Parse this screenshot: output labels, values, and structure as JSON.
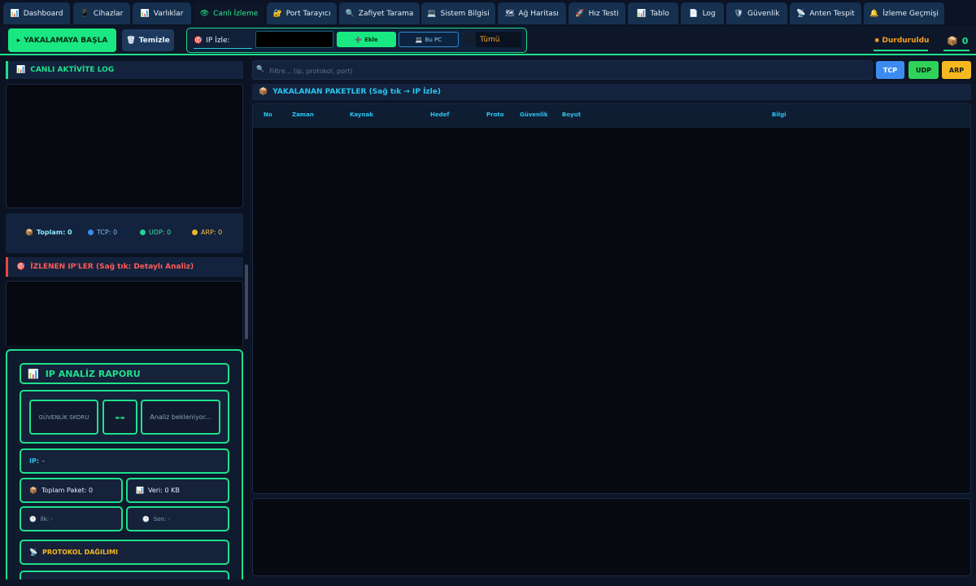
{
  "tabs": [
    {
      "icon": "📊",
      "icon_name": "chart-icon",
      "label": "Dashboard"
    },
    {
      "icon": "📱",
      "icon_name": "phone-icon",
      "label": "Cihazlar"
    },
    {
      "icon": "📊",
      "icon_name": "chart-icon",
      "label": "Varlıklar"
    },
    {
      "icon": "👁",
      "icon_name": "eye-icon",
      "label": "Canlı İzleme",
      "active": true
    },
    {
      "icon": "🔐",
      "icon_name": "lock-icon",
      "label": "Port Tarayıcı"
    },
    {
      "icon": "🔍",
      "icon_name": "search-icon",
      "label": "Zafiyet Tarama"
    },
    {
      "icon": "💻",
      "icon_name": "computer-icon",
      "label": "Sistem Bilgisi"
    },
    {
      "icon": "🗺",
      "icon_name": "map-icon",
      "label": "Ağ Haritası"
    },
    {
      "icon": "🚀",
      "icon_name": "rocket-icon",
      "label": "Hız Testi"
    },
    {
      "icon": "📊",
      "icon_name": "chart-icon",
      "label": "Tablo"
    },
    {
      "icon": "📄",
      "icon_name": "document-icon",
      "label": "Log"
    },
    {
      "icon": "🛡",
      "icon_name": "shield-icon",
      "label": "Güvenlik"
    },
    {
      "icon": "📡",
      "icon_name": "antenna-icon",
      "label": "Anten Tespit"
    },
    {
      "icon": "🔔",
      "icon_name": "bell-icon",
      "label": "İzleme Geçmişi"
    }
  ],
  "toolbar": {
    "start_label": "YAKALAMAYA BAŞLA",
    "start_icon": "▸",
    "clear_label": "Temizle",
    "clear_icon": "🗑",
    "ip_label": "IP İzle:",
    "ip_label_icon": "🎯",
    "ip_value": "",
    "add_label": "Ekle",
    "add_icon": "➕",
    "pc_label": "Bu PC",
    "pc_icon": "💻",
    "select_value": "Tümü",
    "status_label": "Durduruldu",
    "status_icon": "⏹",
    "packet_icon": "📦",
    "packet_count": "0"
  },
  "log": {
    "title": "CANLI AKTİVİTE LOG",
    "title_icon": "📊"
  },
  "stats": {
    "total": {
      "icon": "📦",
      "label": "Toplam: 0"
    },
    "tcp": {
      "label": "TCP: 0",
      "color": "#3d8bf0"
    },
    "udp": {
      "label": "UDP: 0",
      "color": "#22d39a"
    },
    "arp": {
      "label": "ARP: 0",
      "color": "#f0b429"
    }
  },
  "watched": {
    "title": "İZLENEN IP'LER (Sağ tık: Detaylı Analiz)",
    "title_icon": "🎯"
  },
  "report": {
    "title": "IP ANALİZ RAPORU",
    "title_icon": "📊",
    "score_label": "GÜVENLİK SKORU",
    "score_value": "--",
    "analysis_text": "Analiz bekleniyor...",
    "ip_label": "IP:",
    "ip_value": "-",
    "total_packets": "Toplam Paket: 0",
    "total_packets_icon": "📦",
    "data_label": "Veri: 0 KB",
    "data_icon": "📊",
    "first_label": "İlk: -",
    "last_label": "Son: -",
    "time_icon": "🕐",
    "protocol_title": "PROTOKOL DAĞILIMI",
    "protocol_icon": "📡"
  },
  "filter": {
    "placeholder": "Filtre... (ip, protokol, port)",
    "search_icon": "🔍",
    "buttons": [
      {
        "label": "TCP",
        "color": "#3d8bf0"
      },
      {
        "label": "UDP",
        "color": "#2fd35a"
      },
      {
        "label": "ARP",
        "color": "#f5b820"
      }
    ]
  },
  "packets": {
    "title": "YAKALANAN PAKETLER (Sağ tık → IP İzle)",
    "title_icon": "📦",
    "columns": [
      "No",
      "Zaman",
      "Kaynak",
      "Hedef",
      "Proto",
      "Güvenlik",
      "Boyut",
      "Bilgi"
    ]
  }
}
